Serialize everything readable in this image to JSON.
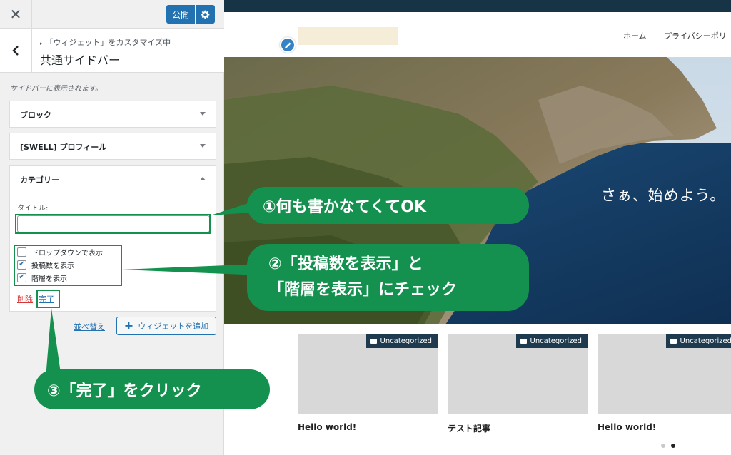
{
  "customizer": {
    "publish_label": "公開",
    "breadcrumb": "「ウィジェット」をカスタマイズ中",
    "section_title": "共通サイドバー",
    "description": "サイドバーに表示されます。",
    "widgets": [
      {
        "label": "ブロック",
        "expanded": false
      },
      {
        "label": "[SWELL] プロフィール",
        "expanded": false
      },
      {
        "label": "カテゴリー",
        "expanded": true
      }
    ],
    "category_form": {
      "title_label": "タイトル:",
      "title_value": "",
      "options": [
        {
          "label": "ドロップダウンで表示",
          "checked": false
        },
        {
          "label": "投稿数を表示",
          "checked": true
        },
        {
          "label": "階層を表示",
          "checked": true
        }
      ],
      "delete_label": "削除",
      "done_label": "完了"
    },
    "reorder_label": "並べ替え",
    "add_widget_label": "ウィジェットを追加"
  },
  "site": {
    "nav": [
      "ホーム",
      "プライバシーポリ"
    ],
    "hero_text": "さぁ、始めよう。",
    "posts": [
      {
        "category": "Uncategorized",
        "title": "Hello world!"
      },
      {
        "category": "Uncategorized",
        "title": "テスト記事"
      },
      {
        "category": "Uncategorized",
        "title": "Hello world!"
      }
    ],
    "slider_pages": 2,
    "slider_current": 2
  },
  "annotations": {
    "callout1": "①何も書かなてくてOK",
    "callout2_line1": "②「投稿数を表示」と",
    "callout2_line2": "「階層を表示」にチェック",
    "callout3": "③「完了」をクリック"
  },
  "colors": {
    "accent": "#2271b1",
    "callout_green": "#14914f",
    "delete_red": "#d63638",
    "site_topbar": "#173346"
  }
}
